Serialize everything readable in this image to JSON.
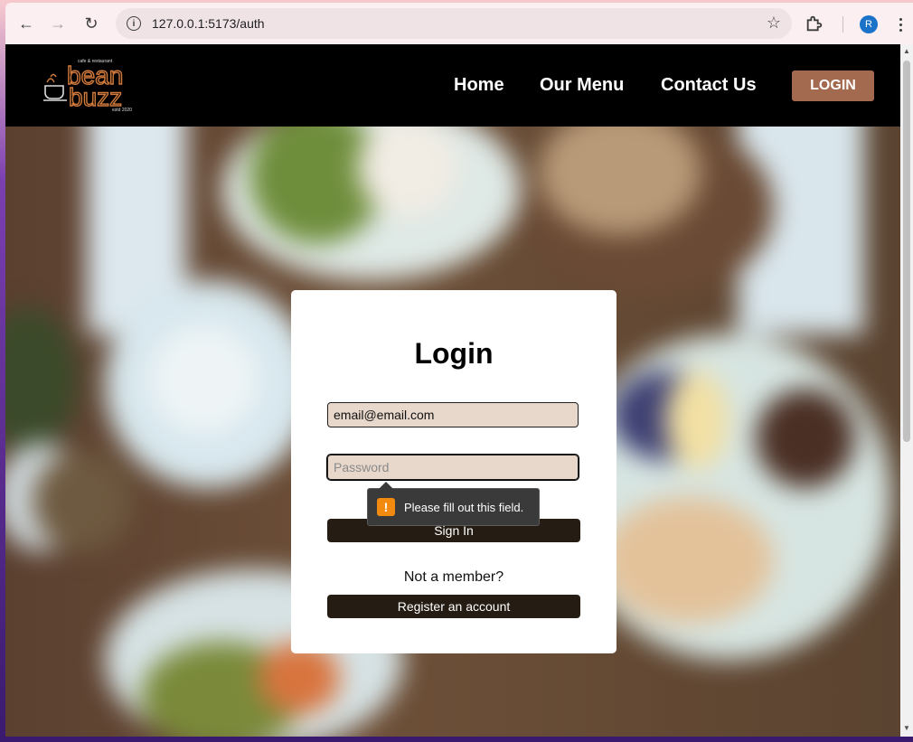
{
  "browser": {
    "url": "127.0.0.1:5173/auth",
    "profile_initial": "R"
  },
  "site": {
    "logo": {
      "tagline": "cafe & restaurant",
      "name_line1": "bean",
      "name_line2": "buzz",
      "established": "estd 2020"
    },
    "nav": [
      {
        "label": "Home"
      },
      {
        "label": "Our Menu"
      },
      {
        "label": "Contact Us"
      }
    ],
    "login_button": "LOGIN"
  },
  "login_form": {
    "title": "Login",
    "email_value": "email@email.com",
    "password_placeholder": "Password",
    "sign_in_label": "Sign In",
    "not_member_text": "Not a member?",
    "register_label": "Register an account"
  },
  "validation": {
    "icon": "warning-icon",
    "message": "Please fill out this field."
  },
  "colors": {
    "header_bg": "#000000",
    "login_btn": "#a46a4f",
    "dark_btn": "#251c13",
    "input_bg": "#e8d8cc"
  }
}
